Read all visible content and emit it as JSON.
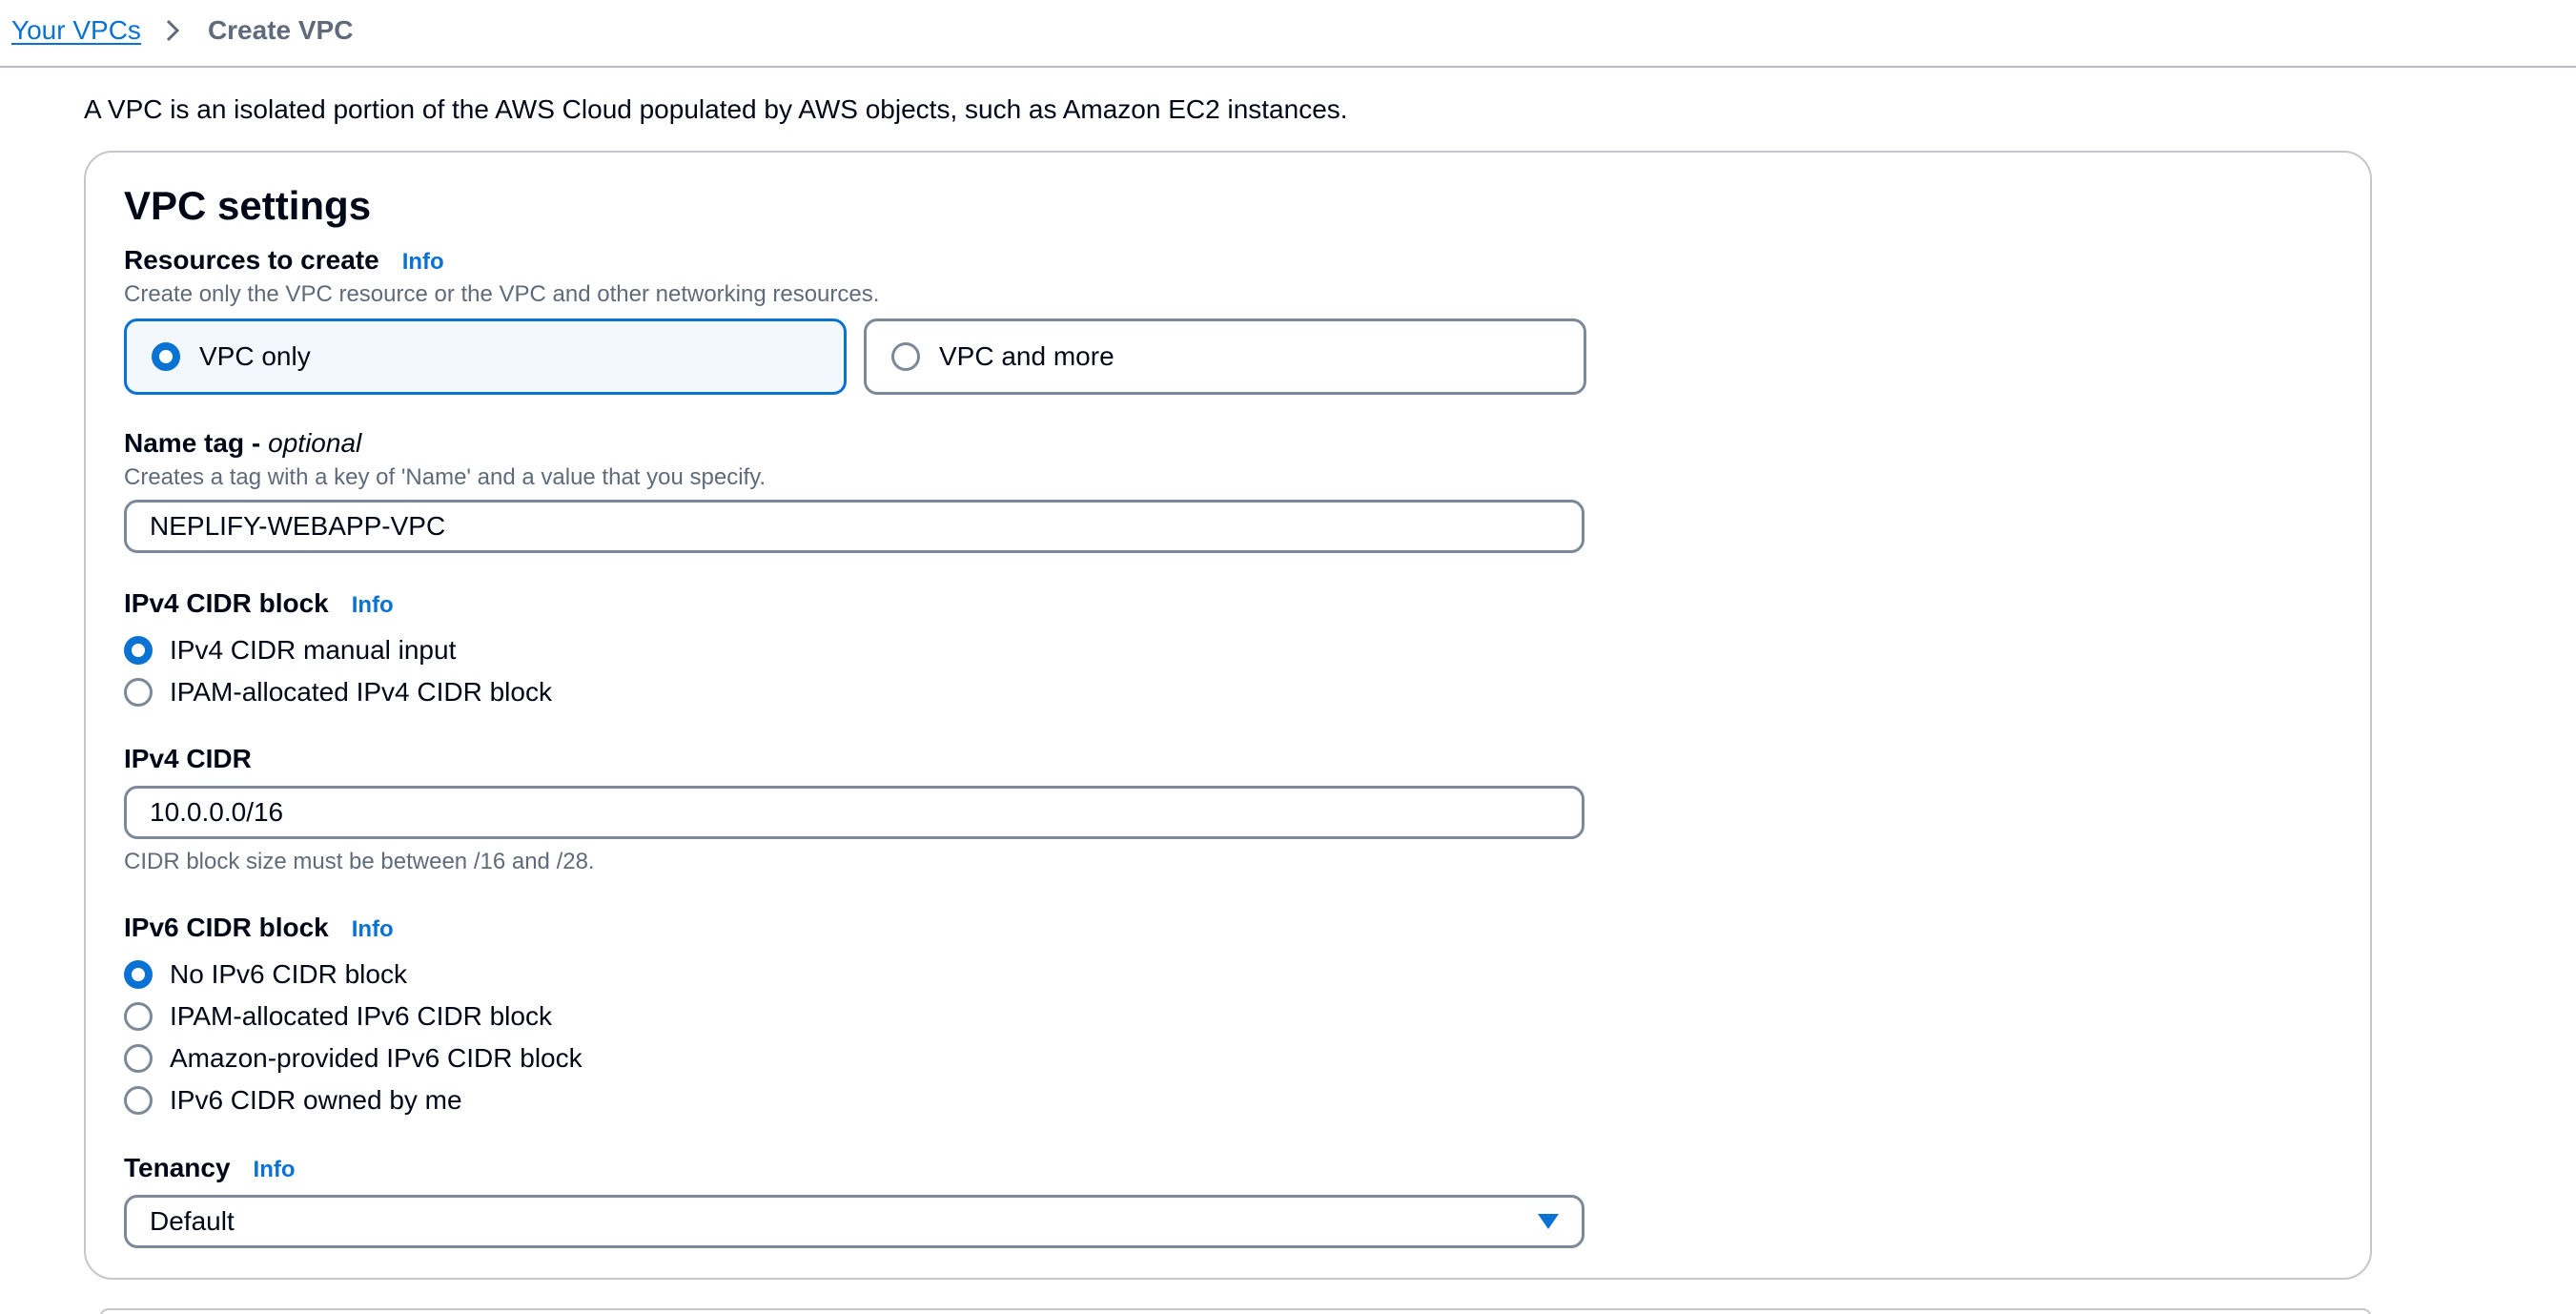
{
  "breadcrumb": {
    "parent": "Your VPCs",
    "current": "Create VPC"
  },
  "intro": "A VPC is an isolated portion of the AWS Cloud populated by AWS objects, such as Amazon EC2 instances.",
  "vpc_settings": {
    "title": "VPC settings",
    "info_label": "Info",
    "resources": {
      "label": "Resources to create",
      "description": "Create only the VPC resource or the VPC and other networking resources.",
      "options": [
        {
          "label": "VPC only",
          "selected": true
        },
        {
          "label": "VPC and more",
          "selected": false
        }
      ]
    },
    "name_tag": {
      "label": "Name tag - ",
      "label_optional": "optional",
      "description": "Creates a tag with a key of 'Name' and a value that you specify.",
      "value": "NEPLIFY-WEBAPP-VPC"
    },
    "ipv4_block": {
      "label": "IPv4 CIDR block",
      "options": [
        {
          "label": "IPv4 CIDR manual input",
          "selected": true
        },
        {
          "label": "IPAM-allocated IPv4 CIDR block",
          "selected": false
        }
      ]
    },
    "ipv4_cidr": {
      "label": "IPv4 CIDR",
      "value": "10.0.0.0/16",
      "hint": "CIDR block size must be between /16 and /28."
    },
    "ipv6_block": {
      "label": "IPv6 CIDR block",
      "options": [
        {
          "label": "No IPv6 CIDR block",
          "selected": true
        },
        {
          "label": "IPAM-allocated IPv6 CIDR block",
          "selected": false
        },
        {
          "label": "Amazon-provided IPv6 CIDR block",
          "selected": false
        },
        {
          "label": "IPv6 CIDR owned by me",
          "selected": false
        }
      ]
    },
    "tenancy": {
      "label": "Tenancy",
      "value": "Default"
    }
  },
  "colors": {
    "accent": "#0972d3",
    "text": "#000716",
    "muted": "#5f6b7a",
    "border": "#7d8998"
  }
}
